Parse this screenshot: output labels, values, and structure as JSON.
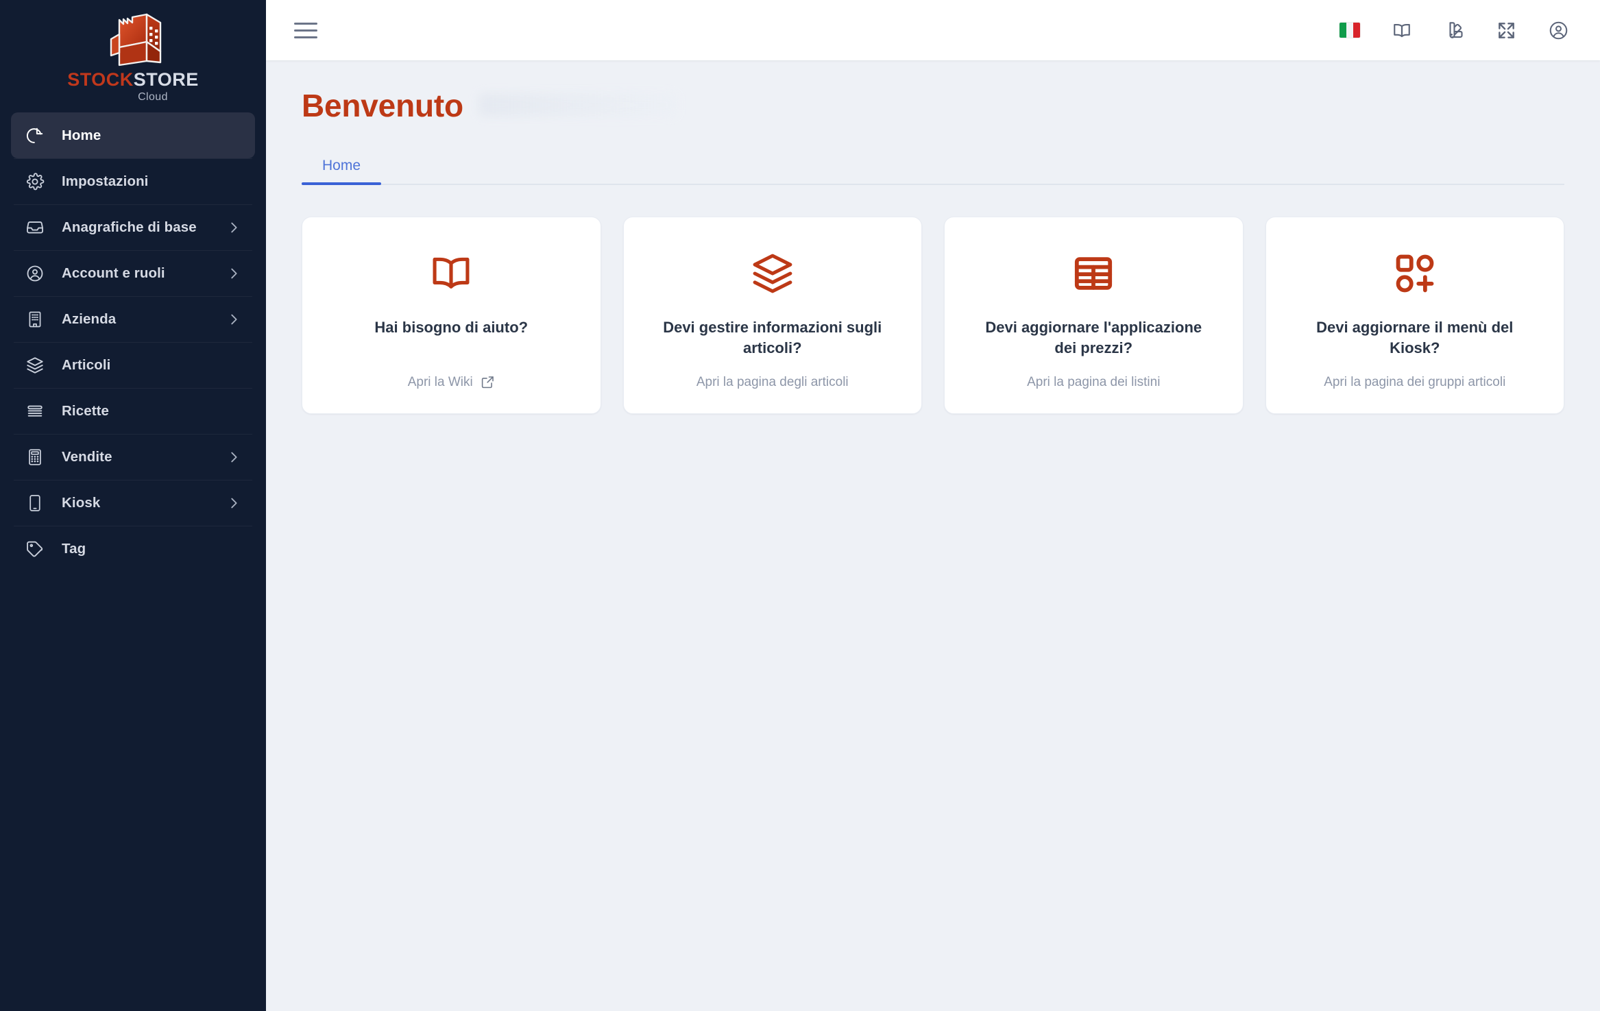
{
  "brand": {
    "word_first": "STOCK",
    "word_second": "STORE",
    "subtitle": "Cloud",
    "logo_icon": "factory-icon"
  },
  "sidebar": {
    "items": [
      {
        "label": "Home",
        "icon": "pie-chart-icon",
        "active": true,
        "expandable": false
      },
      {
        "label": "Impostazioni",
        "icon": "gear-icon",
        "active": false,
        "expandable": false
      },
      {
        "label": "Anagrafiche di base",
        "icon": "inbox-icon",
        "active": false,
        "expandable": true
      },
      {
        "label": "Account e ruoli",
        "icon": "user-circle-icon",
        "active": false,
        "expandable": true
      },
      {
        "label": "Azienda",
        "icon": "building-icon",
        "active": false,
        "expandable": true
      },
      {
        "label": "Articoli",
        "icon": "layers-icon",
        "active": false,
        "expandable": false
      },
      {
        "label": "Ricette",
        "icon": "list-lines-icon",
        "active": false,
        "expandable": false
      },
      {
        "label": "Vendite",
        "icon": "calculator-icon",
        "active": false,
        "expandable": true
      },
      {
        "label": "Kiosk",
        "icon": "tablet-icon",
        "active": false,
        "expandable": true
      },
      {
        "label": "Tag",
        "icon": "tag-icon",
        "active": false,
        "expandable": false
      }
    ]
  },
  "topbar": {
    "menu_icon": "hamburger-icon",
    "actions": [
      {
        "name": "language-flag-italy",
        "icon": "italy-flag-icon"
      },
      {
        "name": "documentation",
        "icon": "book-icon"
      },
      {
        "name": "theme-palette",
        "icon": "color-palette-icon"
      },
      {
        "name": "fullscreen",
        "icon": "expand-icon"
      },
      {
        "name": "user-account",
        "icon": "user-circle-icon"
      }
    ]
  },
  "page": {
    "title": "Benvenuto",
    "title_color": "#bd3916",
    "username_redacted": true
  },
  "tabs": [
    {
      "label": "Home",
      "active": true
    }
  ],
  "cards": [
    {
      "icon": "open-book-icon",
      "title": "Hai bisogno di aiuto?",
      "link": "Apri la Wiki",
      "external": true
    },
    {
      "icon": "layers-icon",
      "title": "Devi gestire informazioni sugli articoli?",
      "link": "Apri la pagina degli articoli",
      "external": false
    },
    {
      "icon": "table-grid-icon",
      "title": "Devi aggiornare l'applicazione dei prezzi?",
      "link": "Apri la pagina dei listini",
      "external": false
    },
    {
      "icon": "grid-plus-icon",
      "title": "Devi aggiornare il menù del Kiosk?",
      "link": "Apri la pagina dei gruppi articoli",
      "external": false
    }
  ],
  "colors": {
    "sidebar_bg": "#111c31",
    "sidebar_active_bg": "#2a3145",
    "content_bg": "#eef1f6",
    "brand_red": "#bd3916",
    "tab_blue": "#3a62d6",
    "card_bg": "#ffffff",
    "muted_text": "#8d96a8"
  }
}
